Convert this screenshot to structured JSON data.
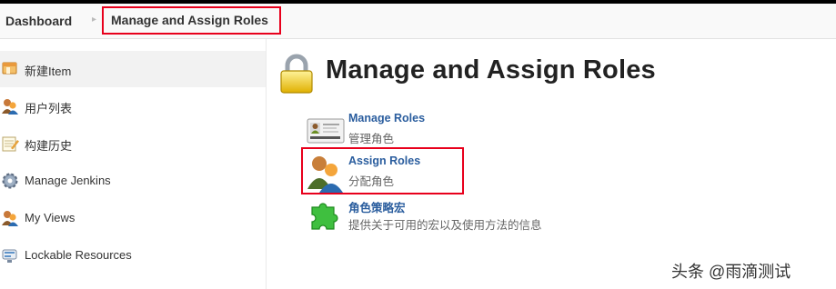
{
  "breadcrumb": {
    "dashboard": "Dashboard",
    "current": "Manage and Assign Roles"
  },
  "sidebar": {
    "items": [
      {
        "label": "新建Item",
        "icon": "new-item-icon"
      },
      {
        "label": "用户列表",
        "icon": "users-icon"
      },
      {
        "label": "构建历史",
        "icon": "notepad-icon"
      },
      {
        "label": "Manage Jenkins",
        "icon": "gear-icon"
      },
      {
        "label": "My Views",
        "icon": "user-icon"
      },
      {
        "label": "Lockable Resources",
        "icon": "resource-icon"
      }
    ]
  },
  "main": {
    "title": "Manage and Assign Roles",
    "title_icon": "lock-icon",
    "items": [
      {
        "title": "Manage Roles",
        "desc": "管理角色",
        "icon": "id-card-icon"
      },
      {
        "title": "Assign Roles",
        "desc": "分配角色",
        "icon": "assign-users-icon"
      },
      {
        "title": "角色策略宏",
        "desc": "提供关于可用的宏以及使用方法的信息",
        "icon": "puzzle-icon"
      }
    ]
  },
  "watermark": "头条 @雨滴测试",
  "colors": {
    "highlight": "#e8001c",
    "link": "#2a5d9e",
    "lock": "#e8c21a",
    "puzzle": "#3fbf3f"
  }
}
